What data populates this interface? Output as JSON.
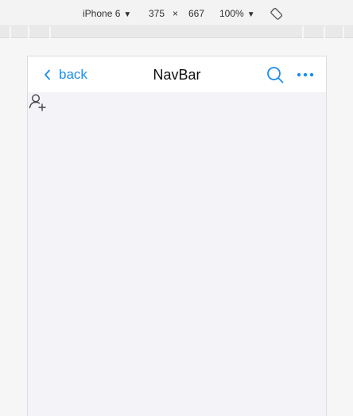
{
  "devtools": {
    "device_name": "iPhone 6",
    "width": "375",
    "times": "×",
    "height": "667",
    "zoom": "100%"
  },
  "navbar": {
    "back_label": "back",
    "title": "NavBar"
  },
  "colors": {
    "accent": "#1f8ceb",
    "navbar_bg": "#ffffff",
    "page_bg": "#f4f4f8"
  },
  "icons": {
    "back": "chevron-left-icon",
    "search": "search-icon",
    "more": "more-horizontal-icon",
    "add_user": "add-user-icon",
    "rotate": "rotate-icon"
  }
}
